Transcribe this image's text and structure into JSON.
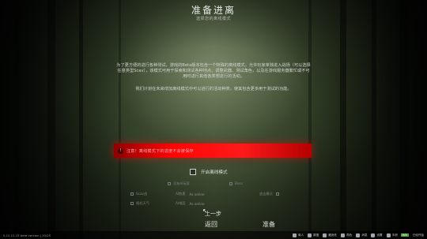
{
  "header": {
    "title": "准备进离",
    "subtitle": "选择您的离线模式"
  },
  "description": {
    "paragraph1": "为了更方便的进行各种测试，游戏的Beta版本包含一个特殊的离线模式，允许玩家单独进入战场（可以选择任意类型Scav），该模式可用于探索和测试各种地点、调整武器、测试角色，以及在游戏服务器繁忙或不可用时进行其他各类想进行的活动。",
    "paragraph2": "我们计划在未来增加离线模式中可以进行的活动种类，使其包含更多用于测试的功能。"
  },
  "warning": {
    "icon": "!",
    "text": "注意！离线模式下的进度不会被保存"
  },
  "offline": {
    "label": "开启离线模式"
  },
  "options": {
    "ai_label": "没有AI玩家",
    "ai_amount_label": "AI数量",
    "ai_amount_value": "As online",
    "difficulty_label": "AI难度",
    "difficulty_value": "As online",
    "enable_bosses": "Boss",
    "scav_war": "Scav战",
    "tagged": "追击模式",
    "random": "随机天气"
  },
  "nav": {
    "prev": "上一步",
    "back": "返回",
    "ready": "准备"
  },
  "statusbar": {
    "version": "0.12.12.15 beta version | 10/25",
    "items": [
      {
        "icon": "trader-icon",
        "label": "商人"
      },
      {
        "icon": "flea-icon",
        "label": "跳蚤"
      },
      {
        "icon": "hideout-icon",
        "label": "藏身处"
      },
      {
        "icon": "character-icon",
        "label": "角色"
      },
      {
        "icon": "messages-icon",
        "label": "消息"
      },
      {
        "icon": "settings-icon",
        "label": "设置"
      },
      {
        "icon": "handbook-icon",
        "label": "手册"
      }
    ],
    "badge": "0/1",
    "clock": "已经开始"
  },
  "colors": {
    "warning": "#ff1a1a",
    "badge": "#4fa83d"
  }
}
